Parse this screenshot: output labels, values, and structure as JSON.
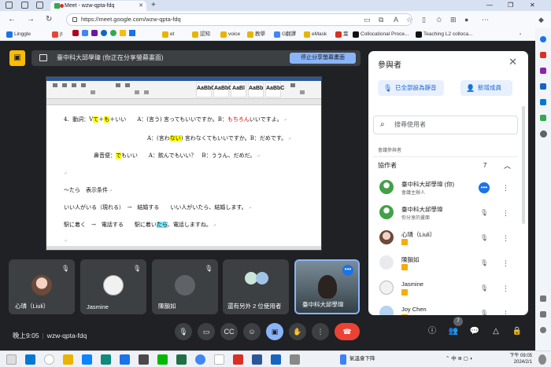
{
  "browser": {
    "tab_title": "Meet - wzw-qpta-fdq",
    "url": "https://meet.google.com/wzw-qpta-fdq",
    "bookmarks": [
      "Linggle",
      "jt",
      "et",
      "認知",
      "voice",
      "教學",
      "G翻譯",
      "eMask",
      "葉",
      "Collocational Proce...",
      "Teaching L2 colloca..."
    ]
  },
  "share": {
    "banner": "臺中科大邱學瑋 (你正在分享螢幕畫面)",
    "stop_button": "停止分享螢幕畫面"
  },
  "document": {
    "lines": [
      {
        "num": "4.",
        "segs": [
          {
            "t": "動詞：V"
          },
          {
            "t": "て",
            "h": "y"
          },
          {
            "t": "＋"
          },
          {
            "t": "も",
            "h": "y"
          },
          {
            "t": "＋いい　　A：(言う) 言ってもいいですか。B："
          },
          {
            "t": "もちろん",
            "h": "r"
          },
          {
            "t": "いいですよ。"
          }
        ]
      },
      {
        "segs": [
          {
            "t": "A：(言わ"
          },
          {
            "t": "ない",
            "h": "y"
          },
          {
            "t": ") 言わなくてもいいですか。B：だめです。"
          }
        ]
      },
      {
        "segs": [
          {
            "t": "鼻音便："
          },
          {
            "t": "で",
            "h": "y"
          },
          {
            "t": "もいい　　A：飲んでもいい？　B：ううん、だめだ。"
          }
        ]
      },
      {
        "segs": [
          {
            "t": "～たら　表示条件"
          }
        ]
      },
      {
        "segs": [
          {
            "t": "いい人がいる（現れる）　→　結婚する　　いい人がいたら、結婚します。"
          }
        ]
      },
      {
        "segs": [
          {
            "t": "駅に着く　→　電話する　　駅に着い"
          },
          {
            "t": "たら",
            "h": "c"
          },
          {
            "t": "、電話しますね。"
          }
        ]
      }
    ],
    "styles": [
      "AaBbCcI",
      "AaBbCcI",
      "AaBl",
      "AaBb",
      "AaBbC"
    ]
  },
  "tiles": [
    {
      "name": "心璘（Liuli）",
      "muted": true
    },
    {
      "name": "Jasmine",
      "muted": true
    },
    {
      "name": "陳韻如",
      "muted": true
    },
    {
      "name": "還有另外 2 位使用者",
      "muted": false
    },
    {
      "name": "臺中科大邱學瑋",
      "muted": false
    }
  ],
  "controls": {
    "time": "晚上9:05",
    "meeting_code": "wzw-qpta-fdq",
    "people_count": "7"
  },
  "panel": {
    "title": "參與者",
    "mute_all": "已全部設為靜音",
    "add_people": "新增成員",
    "search_placeholder": "搜尋使用者",
    "section_label": "會議參與者",
    "group_label": "協作者",
    "group_count": "7",
    "people": [
      {
        "name": "臺中科大邱學瑋 (你)",
        "sub": "會議主辦人"
      },
      {
        "name": "臺中科大邱學瑋",
        "sub": "你分享的畫面"
      },
      {
        "name": "心璘（Liuli）",
        "sub": ""
      },
      {
        "name": "陳韻如",
        "sub": ""
      },
      {
        "name": "Jasmine",
        "sub": ""
      },
      {
        "name": "Joy Chen",
        "sub": ""
      }
    ]
  },
  "taskbar": {
    "weather": "氣溫會下降",
    "clock_time": "下午 09:05",
    "clock_date": "2024/2/1"
  },
  "colors": {
    "meet_bg": "#202124",
    "accent_blue": "#8ab4f8",
    "end_call_red": "#ea4335",
    "present_yellow": "#fbbc04"
  }
}
